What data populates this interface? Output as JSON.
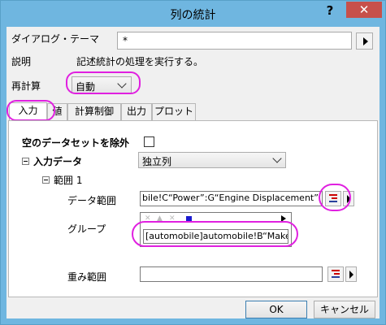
{
  "window": {
    "title": "列の統計",
    "help": "?",
    "close": "✕"
  },
  "dialog_theme": {
    "label": "ダイアログ・テーマ",
    "value": "*"
  },
  "description": {
    "label": "説明",
    "value": "記述統計の処理を実行する。"
  },
  "recalculate": {
    "label": "再計算",
    "value": "自動"
  },
  "tabs": [
    {
      "label": "入力"
    },
    {
      "label": "値"
    },
    {
      "label": "計算制御"
    },
    {
      "label": "出力"
    },
    {
      "label": "プロット"
    }
  ],
  "input": {
    "exclude_empty_label": "空のデータセットを除外",
    "input_data_label": "入力データ",
    "input_data_value": "独立列",
    "range_label": "範囲 1",
    "data_range_label": "データ範囲",
    "data_range_value": "bile!C“Power”:G“Engine Displacement”",
    "group_label": "グループ",
    "group_value": "[automobile]automobile!B“Make”",
    "weight_label": "重み範囲",
    "weight_value": ""
  },
  "buttons": {
    "ok": "OK",
    "cancel": "キャンセル"
  },
  "colors": {
    "titlebar": "#6fb6e0",
    "close": "#c7504b",
    "highlight": "#e020e0"
  }
}
